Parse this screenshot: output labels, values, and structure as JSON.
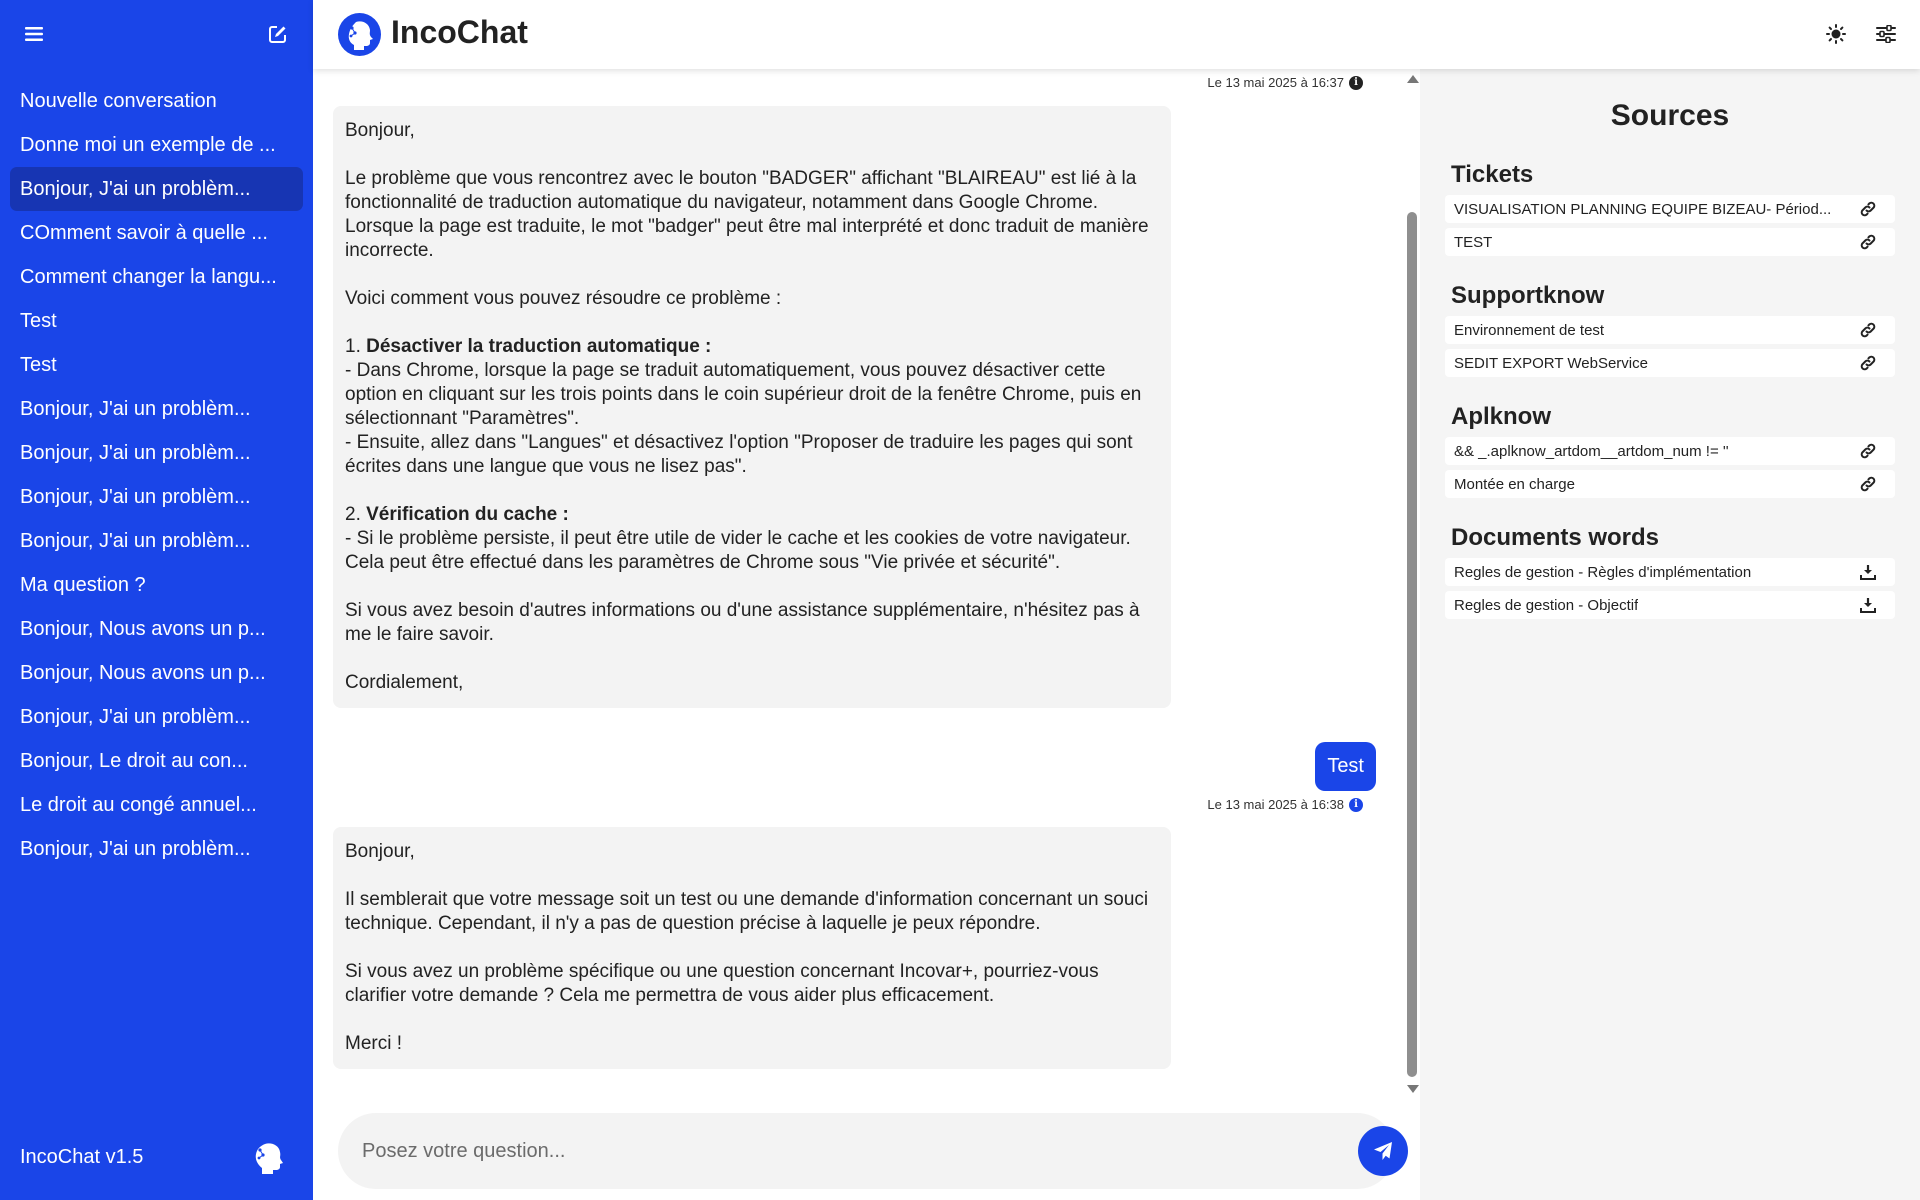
{
  "app": {
    "title": "IncoChat",
    "version": "IncoChat v1.5"
  },
  "colors": {
    "brand": "#1a45e8",
    "active_item": "#1735b3",
    "bubble_bg": "#f3f3f3",
    "sources_bg": "#f5f5f5"
  },
  "sidebar": {
    "icons": {
      "menu": "hamburger-icon",
      "new": "edit-icon"
    },
    "conversations": [
      {
        "label": "Nouvelle conversation"
      },
      {
        "label": "Donne moi un exemple de ..."
      },
      {
        "label": "Bonjour, J'ai un problèm..."
      },
      {
        "label": "COmment savoir à quelle ..."
      },
      {
        "label": "Comment changer la langu..."
      },
      {
        "label": "Test"
      },
      {
        "label": "Test"
      },
      {
        "label": "Bonjour, J'ai un problèm..."
      },
      {
        "label": "Bonjour, J'ai un problèm..."
      },
      {
        "label": "Bonjour, J'ai un problèm..."
      },
      {
        "label": "Bonjour, J'ai un problèm..."
      },
      {
        "label": "Ma question ?"
      },
      {
        "label": "Bonjour, Nous avons un p..."
      },
      {
        "label": "Bonjour, Nous avons un p..."
      },
      {
        "label": "Bonjour, J'ai un problèm..."
      },
      {
        "label": "Bonjour, Le droit au con..."
      },
      {
        "label": "Le droit au congé annuel..."
      },
      {
        "label": "Bonjour, J'ai un problèm..."
      }
    ],
    "active_index": 2
  },
  "header": {
    "icons": {
      "theme": "sun-icon",
      "settings": "sliders-icon"
    }
  },
  "chat": {
    "messages": [
      {
        "timestamp": "Le 13 mai 2025 à 16:37",
        "greeting": "Bonjour,",
        "p1": "Le problème que vous rencontrez avec le bouton \"BADGER\" affichant \"BLAIREAU\" est lié à la fonctionnalité de traduction automatique du navigateur, notamment dans Google Chrome. Lorsque la page est traduite, le mot \"badger\" peut être mal interprété et donc traduit de manière incorrecte.",
        "p2": "Voici comment vous pouvez résoudre ce problème :",
        "s1_num": "1. ",
        "s1_title": "Désactiver la traduction automatique :",
        "s1_l1": "- Dans Chrome, lorsque la page se traduit automatiquement, vous pouvez désactiver cette option en cliquant sur les trois points dans le coin supérieur droit de la fenêtre Chrome, puis en sélectionnant \"Paramètres\".",
        "s1_l2": "- Ensuite, allez dans \"Langues\" et désactivez l'option \"Proposer de traduire les pages qui sont écrites dans une langue que vous ne lisez pas\".",
        "s2_num": "2. ",
        "s2_title": "Vérification du cache :",
        "s2_l1": "- Si le problème persiste, il peut être utile de vider le cache et les cookies de votre navigateur. Cela peut être effectué dans les paramètres de Chrome sous \"Vie privée et sécurité\".",
        "p3": "Si vous avez besoin d'autres informations ou d'une assistance supplémentaire, n'hésitez pas à me le faire savoir.",
        "closing": "Cordialement,"
      },
      {
        "user_text": "Test"
      },
      {
        "timestamp": "Le 13 mai 2025 à 16:38",
        "greeting": "Bonjour,",
        "p1": "Il semblerait que votre message soit un test ou une demande d'information concernant un souci technique. Cependant, il n'y a pas de question précise à laquelle je peux répondre.",
        "p2": "Si vous avez un problème spécifique ou une question concernant Incovar+, pourriez-vous clarifier votre demande ? Cela me permettra de vous aider plus efficacement.",
        "closing": "Merci !"
      }
    ],
    "input": {
      "placeholder": "Posez votre question...",
      "value": ""
    }
  },
  "sources": {
    "title": "Sources",
    "sections": [
      {
        "heading": "Tickets",
        "icon": "link-icon",
        "items": [
          {
            "label": "VISUALISATION PLANNING EQUIPE BIZEAU- Périod..."
          },
          {
            "label": "TEST"
          }
        ]
      },
      {
        "heading": "Supportknow",
        "icon": "link-icon",
        "items": [
          {
            "label": "Environnement de test"
          },
          {
            "label": "SEDIT EXPORT WebService"
          }
        ]
      },
      {
        "heading": "Aplknow",
        "icon": "link-icon",
        "items": [
          {
            "label": "&& _.aplknow_artdom__artdom_num != ''"
          },
          {
            "label": "Montée en charge"
          }
        ]
      },
      {
        "heading": "Documents words",
        "icon": "download-icon",
        "items": [
          {
            "label": "Regles de gestion - Règles d'implémentation"
          },
          {
            "label": "Regles de gestion - Objectif"
          }
        ]
      }
    ]
  }
}
